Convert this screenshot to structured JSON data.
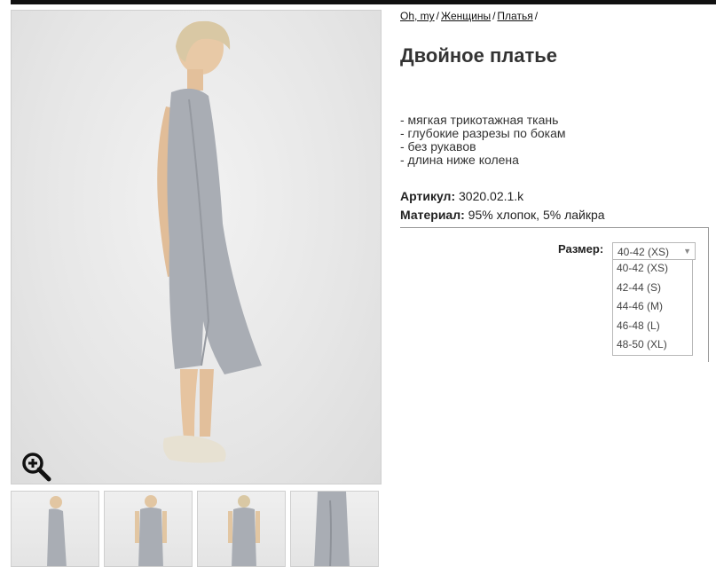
{
  "breadcrumb": {
    "items": [
      "Oh, my",
      "Женщины",
      "Платья"
    ],
    "separator": "/"
  },
  "product": {
    "title": "Двойное платье",
    "features": [
      "- мягкая трикотажная ткань",
      "- глубокие разрезы по бокам",
      "- без рукавов",
      "- длина ниже колена"
    ],
    "sku_label": "Артикул:",
    "sku_value": "3020.02.1.k",
    "material_label": "Материал:",
    "material_value": "95% хлопок, 5% лайкра"
  },
  "size": {
    "label": "Размер:",
    "selected": "40-42 (XS)",
    "options": [
      "40-42 (XS)",
      "42-44 (S)",
      "44-46 (M)",
      "46-48 (L)",
      "48-50 (XL)"
    ]
  },
  "gallery": {
    "zoom_icon": "zoom-in-icon",
    "thumbnail_count": 4
  },
  "colors": {
    "dress": "#a9adb4",
    "topbar": "#111111"
  }
}
